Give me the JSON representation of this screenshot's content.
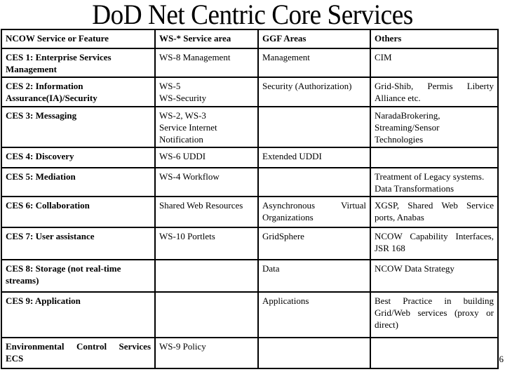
{
  "slide": {
    "title": "DoD Net Centric Core Services",
    "page_number": "6"
  },
  "table": {
    "headers": [
      "NCOW Service or Feature",
      "WS-* Service area",
      "GGF Areas",
      "Others"
    ],
    "rows": [
      {
        "feature": "CES 1: Enterprise Services Management",
        "ws": "WS-8 Management",
        "ggf": "Management",
        "others": "CIM"
      },
      {
        "feature": "CES 2: Information Assurance(IA)/Security",
        "ws_lines": [
          "WS-5",
          "WS-Security"
        ],
        "ggf": "Security (Authorization)",
        "others": "Grid-Shib, Permis Liberty Alliance etc."
      },
      {
        "feature": "CES 3: Messaging",
        "ws_lines": [
          "WS-2, WS-3",
          "Service Internet",
          "Notification"
        ],
        "ggf": "",
        "others_lines": [
          "NaradaBrokering,",
          "Streaming/Sensor",
          "Technologies"
        ]
      },
      {
        "feature": "CES 4: Discovery",
        "ws": "WS-6 UDDI",
        "ggf": "Extended UDDI",
        "others": ""
      },
      {
        "feature": "CES 5: Mediation",
        "ws": "WS-4 Workflow",
        "ggf": "",
        "others_lines": [
          "Treatment of Legacy systems.",
          "Data Transformations"
        ]
      },
      {
        "feature": "CES 6: Collaboration",
        "ws": "Shared Web Resources",
        "ggf": "Asynchronous Virtual Organizations",
        "others": "XGSP, Shared Web Service ports, Anabas"
      },
      {
        "feature": "CES 7: User assistance",
        "ws": "WS-10 Portlets",
        "ggf": "GridSphere",
        "others": "NCOW Capability Interfaces, JSR 168"
      },
      {
        "feature": "CES 8: Storage (not real-time streams)",
        "ws": "",
        "ggf": "Data",
        "others": "NCOW Data Strategy"
      },
      {
        "feature": "CES 9: Application",
        "ws": "",
        "ggf": "Applications",
        "others": "Best Practice in building Grid/Web services (proxy or direct)"
      },
      {
        "feature": "Environmental Control Services ECS",
        "ws": "WS-9 Policy",
        "ggf": "",
        "others": ""
      }
    ]
  }
}
